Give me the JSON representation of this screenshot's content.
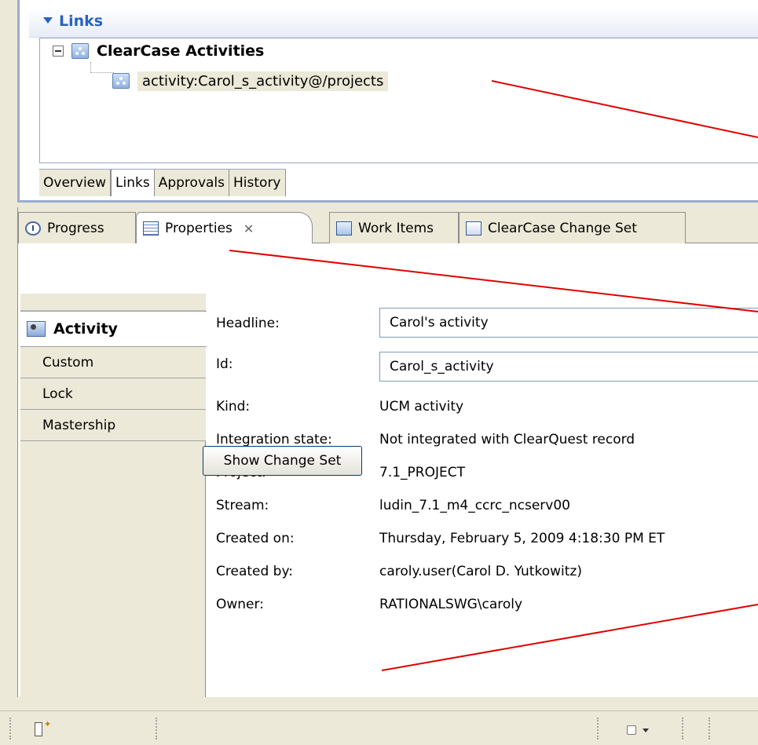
{
  "links_section": {
    "title": "Links",
    "tree": {
      "parent_label": "ClearCase Activities",
      "child_label": "activity:Carol_s_activity@/projects"
    }
  },
  "editor_tabs": [
    "Overview",
    "Links",
    "Approvals",
    "History"
  ],
  "view_tabs": {
    "progress": "Progress",
    "properties": "Properties",
    "work_items": "Work Items",
    "change_set": "ClearCase Change Set",
    "close_glyph": "✕"
  },
  "side_tabs": {
    "activity": "Activity",
    "custom": "Custom",
    "lock": "Lock",
    "mastership": "Mastership"
  },
  "properties": {
    "headline_label": "Headline:",
    "headline_value": "Carol's activity",
    "id_label": "Id:",
    "id_value": "Carol_s_activity",
    "kind_label": "Kind:",
    "kind_value": "UCM activity",
    "integration_label": "Integration state:",
    "integration_value": "Not integrated with ClearQuest record",
    "project_label": "Project:",
    "project_value": "7.1_PROJECT",
    "stream_label": "Stream:",
    "stream_value": "ludin_7.1_m4_ccrc_ncserv00",
    "created_on_label": "Created on:",
    "created_on_value": "Thursday, February 5, 2009 4:18:30 PM ET",
    "created_by_label": "Created by:",
    "created_by_value": "caroly.user(Carol D. Yutkowitz)",
    "owner_label": "Owner:",
    "owner_value": "RATIONALSWG\\caroly"
  },
  "show_change_set_button": "Show Change Set",
  "colors": {
    "section_title": "#2a63bd",
    "callout_line": "#e00000",
    "chrome": "#ece9d8"
  }
}
